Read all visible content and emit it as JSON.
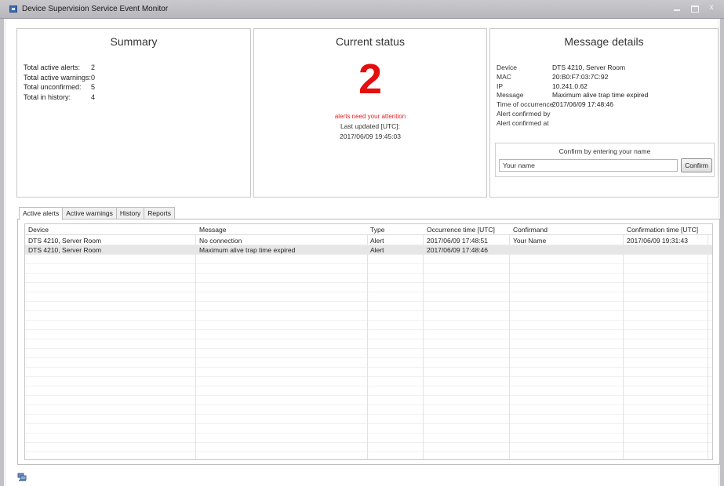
{
  "window": {
    "title": "Device Supervision Service Event Monitor",
    "close_glyph": "x"
  },
  "summary": {
    "title": "Summary",
    "rows": [
      {
        "label": "Total active alerts:",
        "value": "2"
      },
      {
        "label": "Total active warnings:",
        "value": "0"
      },
      {
        "label": "Total unconfirmed:",
        "value": "5"
      },
      {
        "label": "Total in history:",
        "value": "4"
      }
    ]
  },
  "status": {
    "title": "Current status",
    "count": "2",
    "attention_text": "alerts need your attention",
    "last_updated_label": "Last updated [UTC]:",
    "last_updated_value": "2017/06/09 19:45:03",
    "count_color": "#e40e0e"
  },
  "details": {
    "title": "Message details",
    "rows": [
      {
        "label": "Device",
        "value": "DTS 4210, Server Room"
      },
      {
        "label": "MAC",
        "value": "20:B0:F7:03:7C:92"
      },
      {
        "label": "IP",
        "value": "10.241.0.62"
      },
      {
        "label": "Message",
        "value": "Maximum alive trap time expired"
      },
      {
        "label": "Time of occurrence",
        "value": "2017/06/09 17:48:46"
      },
      {
        "label": "Alert confirmed by",
        "value": ""
      },
      {
        "label": "Alert confirmed at",
        "value": ""
      }
    ],
    "confirm_title": "Confirm by entering your name",
    "name_value": "Your name",
    "confirm_button": "Confirm"
  },
  "tabs": [
    {
      "label": "Active alerts",
      "active": true
    },
    {
      "label": "Active warnings",
      "active": false
    },
    {
      "label": "History",
      "active": false
    },
    {
      "label": "Reports",
      "active": false
    }
  ],
  "table": {
    "columns": [
      "Device",
      "Message",
      "Type",
      "Occurrence time [UTC]",
      "Confirmand",
      "Confirmation time [UTC]"
    ],
    "rows": [
      [
        "DTS 4210, Server Room",
        "No connection",
        "Alert",
        "2017/06/09 17:48:51",
        "Your Name",
        "2017/06/09 19:31:43"
      ],
      [
        "DTS 4210, Server Room",
        "Maximum alive trap time expired",
        "Alert",
        "2017/06/09 17:48:46",
        "",
        ""
      ]
    ],
    "selected_row": 1
  },
  "statusbar": {
    "icon": "connection-icon"
  }
}
